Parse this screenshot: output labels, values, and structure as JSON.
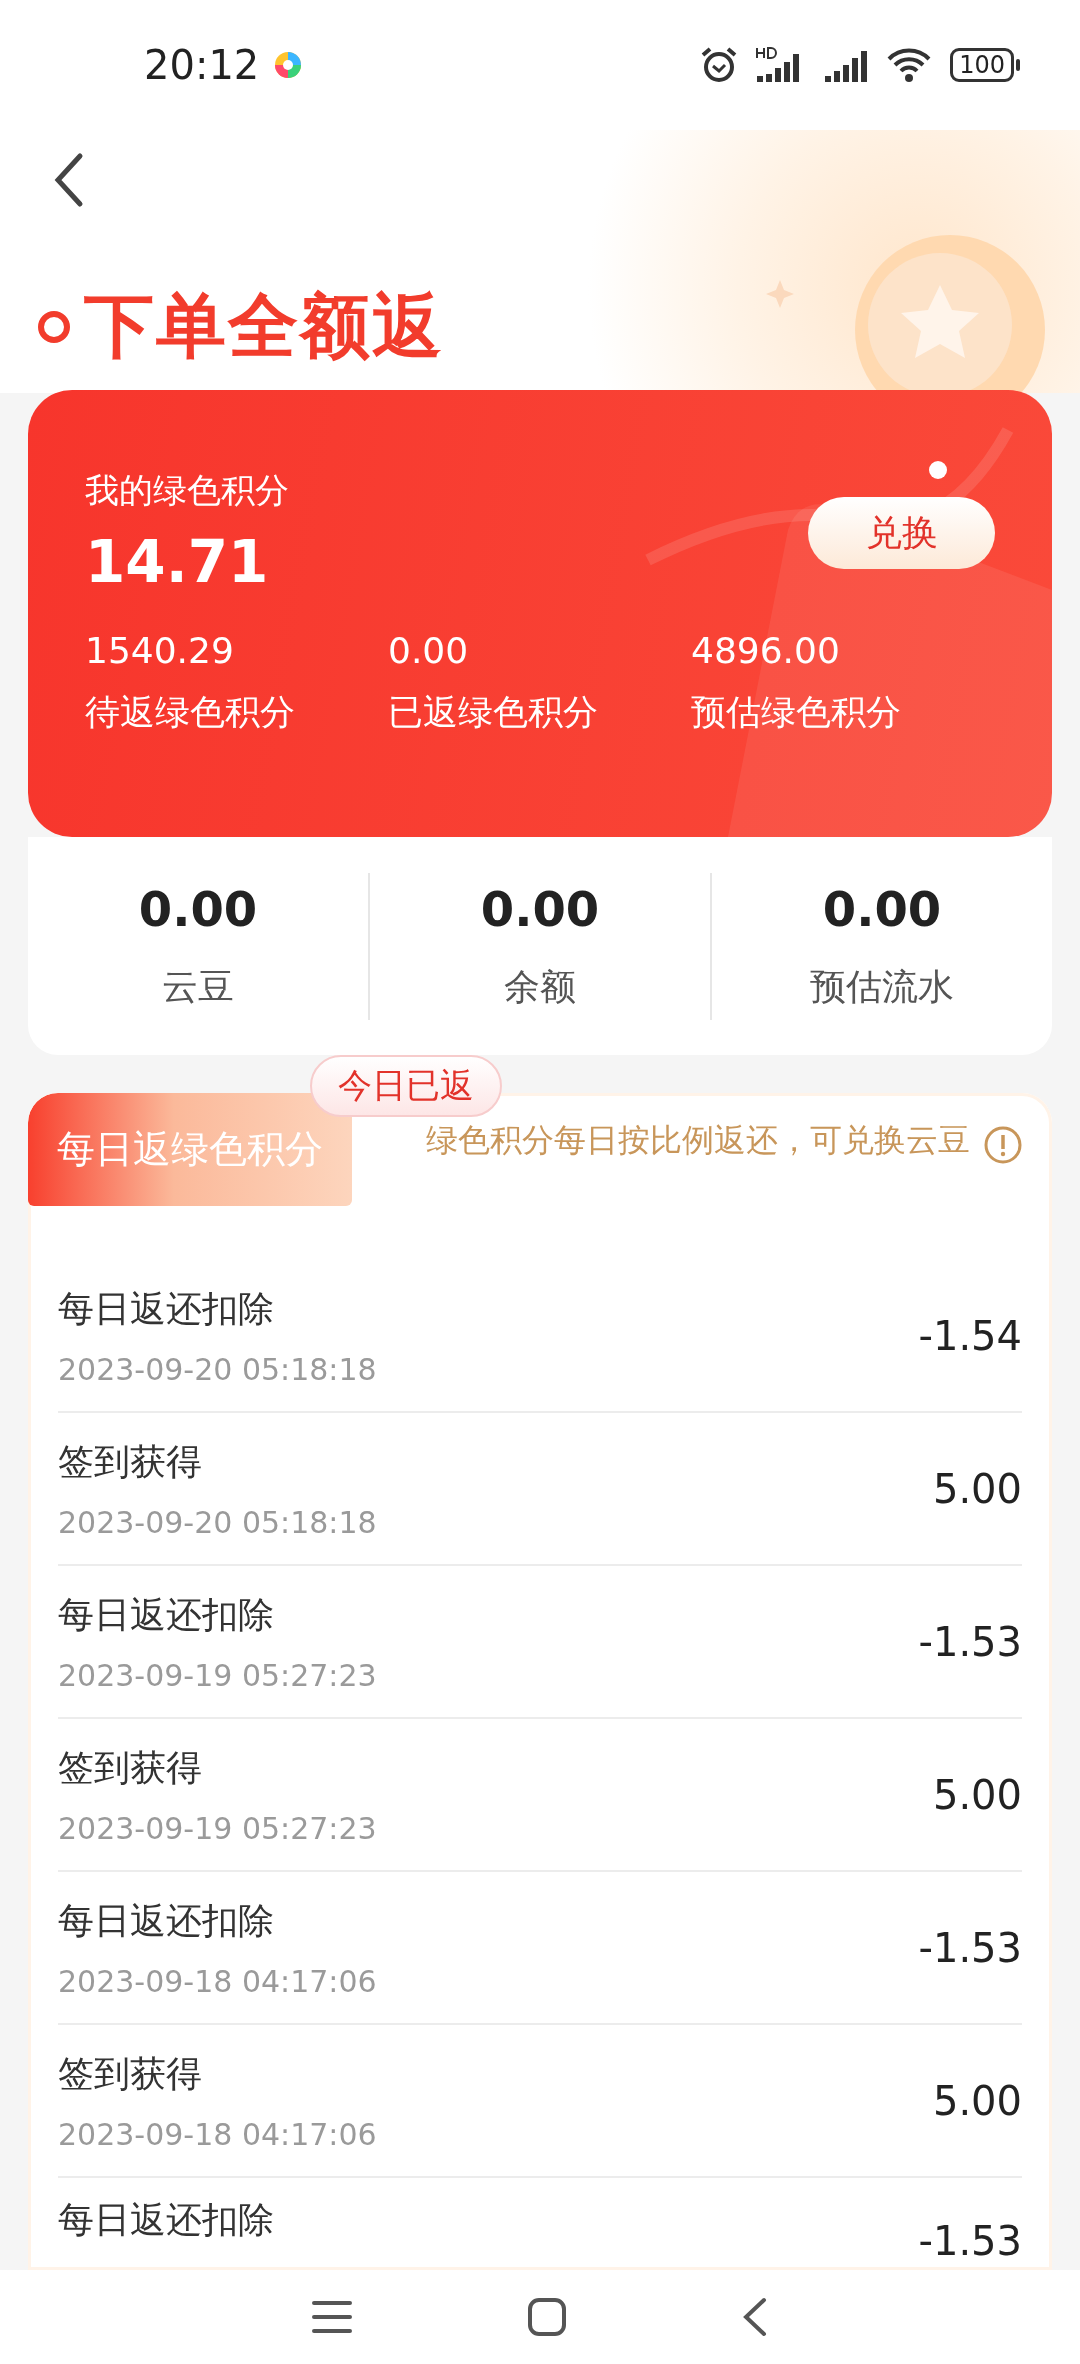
{
  "status_bar": {
    "time": "20:12",
    "battery": "100"
  },
  "title": "下单全额返",
  "points_card": {
    "label": "我的绿色积分",
    "value": "14.71",
    "button": "兑换",
    "stats": [
      {
        "value": "1540.29",
        "label": "待返绿色积分"
      },
      {
        "value": "0.00",
        "label": "已返绿色积分"
      },
      {
        "value": "4896.00",
        "label": "预估绿色积分"
      }
    ]
  },
  "summary": [
    {
      "value": "0.00",
      "label": "云豆"
    },
    {
      "value": "0.00",
      "label": "余额"
    },
    {
      "value": "0.00",
      "label": "预估流水"
    }
  ],
  "daily": {
    "tab": "每日返绿色积分",
    "badge": "今日已返",
    "info": "绿色积分每日按比例返还，可兑换云豆"
  },
  "records": [
    {
      "title": "每日返还扣除",
      "date": "2023-09-20 05:18:18",
      "amount": "-1.54"
    },
    {
      "title": "签到获得",
      "date": "2023-09-20 05:18:18",
      "amount": "5.00"
    },
    {
      "title": "每日返还扣除",
      "date": "2023-09-19 05:27:23",
      "amount": "-1.53"
    },
    {
      "title": "签到获得",
      "date": "2023-09-19 05:27:23",
      "amount": "5.00"
    },
    {
      "title": "每日返还扣除",
      "date": "2023-09-18 04:17:06",
      "amount": "-1.53"
    },
    {
      "title": "签到获得",
      "date": "2023-09-18 04:17:06",
      "amount": "5.00"
    },
    {
      "title": "每日返还扣除",
      "amount": "-1.53"
    }
  ]
}
